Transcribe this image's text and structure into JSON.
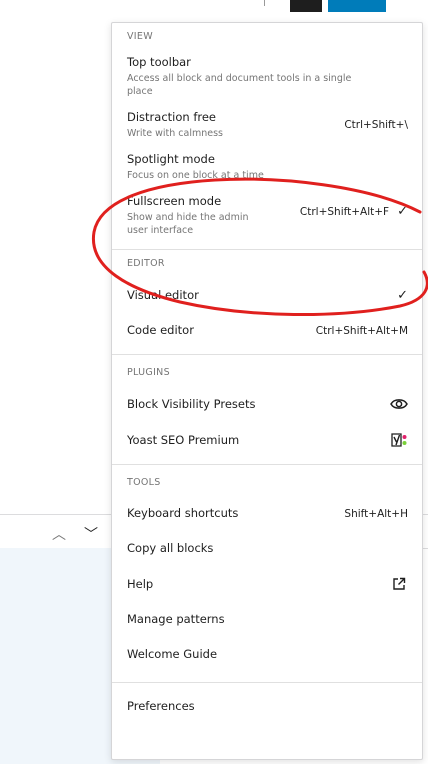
{
  "menu": {
    "groups": [
      {
        "title": "VIEW",
        "items": [
          {
            "label": "Top toolbar",
            "desc": "Access all block and document tools in a single place",
            "shortcut": "",
            "checked": false
          },
          {
            "label": "Distraction free",
            "desc": "Write with calmness",
            "shortcut": "Ctrl+Shift+\\",
            "checked": false
          },
          {
            "label": "Spotlight mode",
            "desc": "Focus on one block at a time",
            "shortcut": "",
            "checked": false
          },
          {
            "label": "Fullscreen mode",
            "desc": "Show and hide the admin user interface",
            "shortcut": "Ctrl+Shift+Alt+F",
            "checked": true
          }
        ]
      },
      {
        "title": "EDITOR",
        "items": [
          {
            "label": "Visual editor",
            "shortcut": "",
            "checked": true
          },
          {
            "label": "Code editor",
            "shortcut": "Ctrl+Shift+Alt+M",
            "checked": false
          }
        ]
      },
      {
        "title": "PLUGINS",
        "items": [
          {
            "label": "Block Visibility Presets",
            "icon": "eye-icon"
          },
          {
            "label": "Yoast SEO Premium",
            "icon": "yoast-icon"
          }
        ]
      },
      {
        "title": "TOOLS",
        "items": [
          {
            "label": "Keyboard shortcuts",
            "shortcut": "Shift+Alt+H"
          },
          {
            "label": "Copy all blocks"
          },
          {
            "label": "Help",
            "icon": "external-link-icon"
          },
          {
            "label": "Manage patterns"
          },
          {
            "label": "Welcome Guide"
          }
        ]
      }
    ],
    "preferences_label": "Preferences",
    "check_glyph": "✓"
  },
  "background": {
    "arrow_up": "^",
    "arrow_down": "⌄"
  },
  "colors": {
    "accent": "#007cba",
    "annotation": "#e0201e",
    "dark_button": "#1e1e1e"
  }
}
